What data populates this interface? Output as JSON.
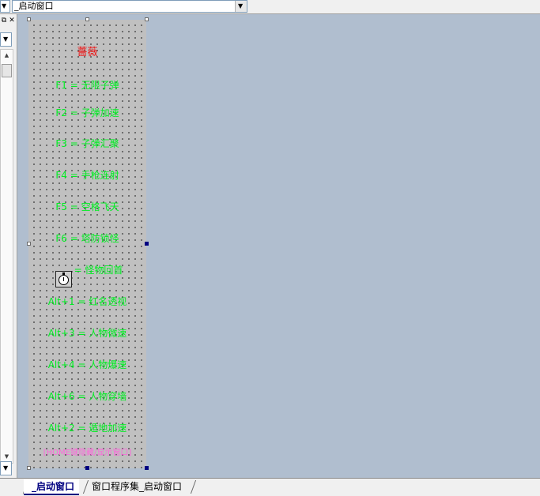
{
  "top": {
    "window_select_value": "_启动窗口"
  },
  "form": {
    "title": "薔薇",
    "labels": [
      "F1 = 无限子弹",
      "F2 = 子弹加速",
      "F3 = 子弹汇聚",
      "F4 = 手枪连射",
      "F5 = 空格飞天",
      "F6 = 塔防锁怪",
      "= 怪物回首",
      "Alt+1 = 红名透视",
      "Alt+3 = 人物微速",
      "Alt+4 = 人物爆速",
      "Alt+6 = 人物穿墙",
      "Alt+2 = 遁地加速"
    ],
    "footer_label": "[HOME键隐藏/显示窗口]"
  },
  "tabs": [
    {
      "label": "_启动窗口",
      "active": true
    },
    {
      "label": "窗口程序集_启动窗口",
      "active": false
    }
  ],
  "colors": {
    "canvas_bg": "#b0becf",
    "form_bg": "#c0c0c0",
    "label_green": "#00ee22",
    "title_red": "#ee1111",
    "footer_pink": "#ff66dd"
  },
  "icons": {
    "timer": "stopwatch-icon",
    "dropdown": "chevron-down-icon",
    "close": "close-icon",
    "restore": "restore-icon"
  }
}
